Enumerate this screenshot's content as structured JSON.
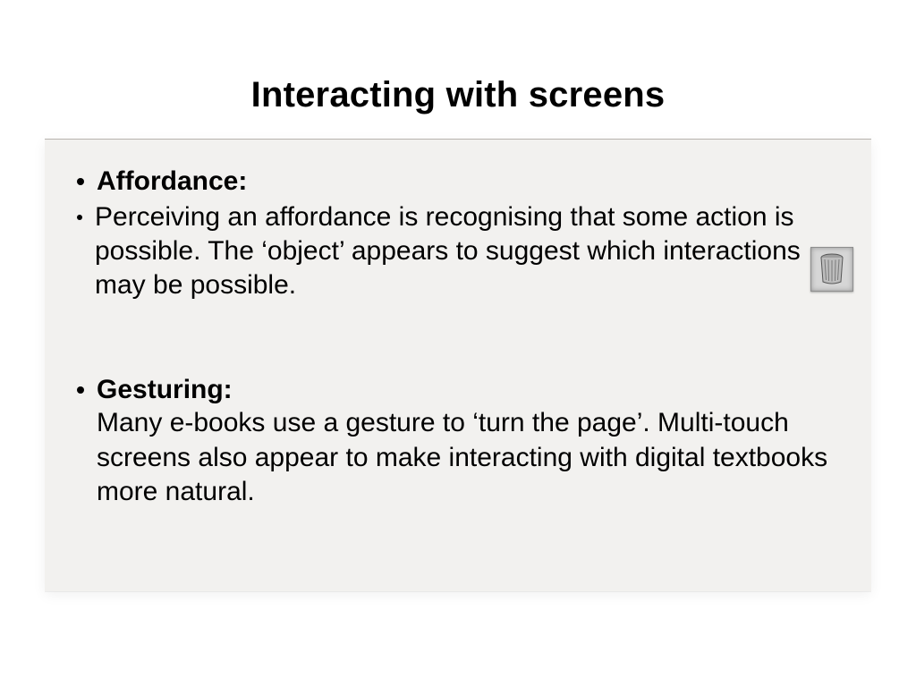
{
  "title": "Interacting with screens",
  "sections": [
    {
      "heading": "Affordance:",
      "body": "Perceiving an affordance is recognising that some action is possible. The ‘object’ appears to suggest which interactions may be possible."
    },
    {
      "heading": "Gesturing:",
      "body": "Many e-books use a gesture to ‘turn the page’. Multi-touch screens also appear to make interacting with digital textbooks more natural."
    }
  ],
  "image": {
    "name": "trash-can-icon"
  }
}
